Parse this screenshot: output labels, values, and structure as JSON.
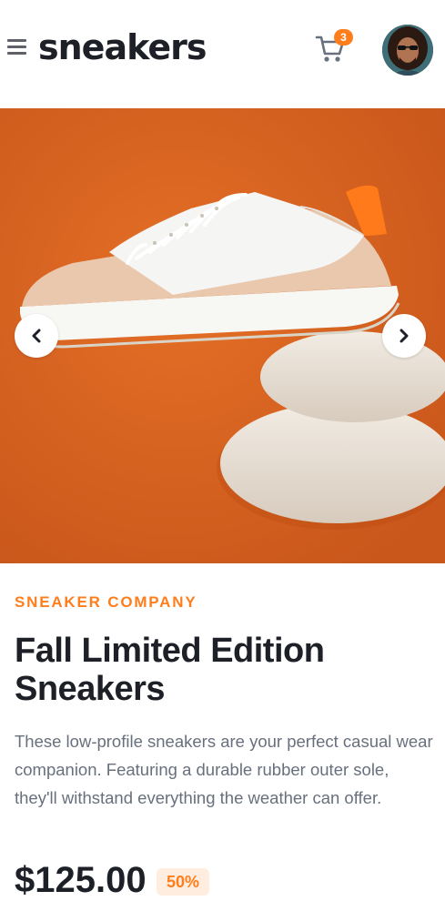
{
  "header": {
    "logo": "sneakers",
    "cart_count": "3",
    "avatar_alt": "user avatar"
  },
  "product": {
    "company": "SNEAKER COMPANY",
    "title": "Fall Limited Edition Sneakers",
    "description": "These low-profile sneakers are your perfect casual wear companion. Featuring a durable rubber outer sole, they'll withstand everything the weather can offer.",
    "price": "$125.00",
    "discount": "50%"
  },
  "colors": {
    "accent": "#ff7e1b",
    "accent_pale": "#ffede0",
    "text_dark": "#1d2026",
    "text_gray": "#68707d",
    "gallery_bg": "#e2681f"
  },
  "icons": [
    "menu-icon",
    "cart-icon",
    "chevron-left-icon",
    "chevron-right-icon"
  ]
}
